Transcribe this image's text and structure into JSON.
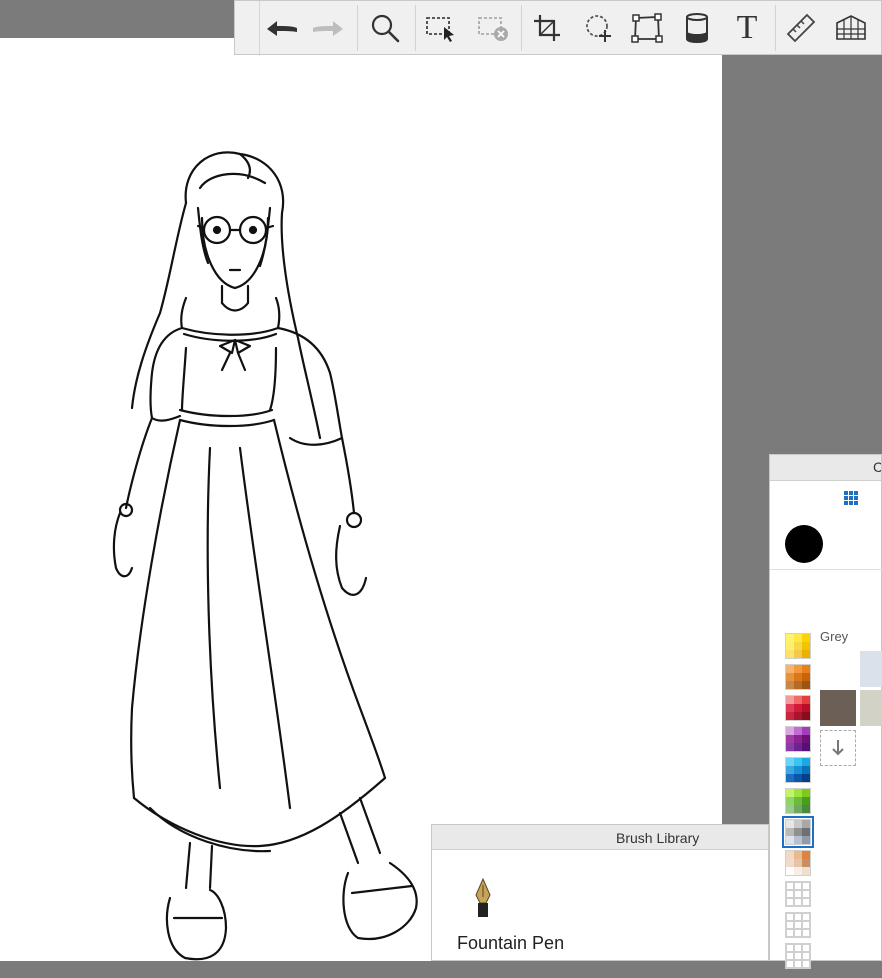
{
  "toolbar": {
    "tools": [
      {
        "name": "undo-icon",
        "label": "Undo"
      },
      {
        "name": "redo-icon",
        "label": "Redo"
      },
      {
        "name": "zoom-icon",
        "label": "Zoom"
      },
      {
        "name": "select-icon",
        "label": "Select"
      },
      {
        "name": "deselect-icon",
        "label": "Deselect"
      },
      {
        "name": "crop-icon",
        "label": "Crop"
      },
      {
        "name": "transform-icon",
        "label": "Transform"
      },
      {
        "name": "distort-icon",
        "label": "Distort"
      },
      {
        "name": "fill-icon",
        "label": "Fill"
      },
      {
        "name": "text-icon",
        "label": "Text"
      },
      {
        "name": "ruler-icon",
        "label": "Ruler"
      },
      {
        "name": "perspective-icon",
        "label": "Perspective"
      }
    ],
    "text_tool_glyph": "T"
  },
  "color_panel": {
    "title": "C",
    "current_color": "#000000",
    "category_label": "Grey",
    "grey_swatches": [
      "#dbe1ea",
      "#6b5f56",
      "#d3d2c6"
    ],
    "categories": [
      {
        "name": "yellow",
        "colors": [
          "#fff36b",
          "#ffe94a",
          "#ffd300",
          "#fff06b",
          "#f9d74a",
          "#f3c300",
          "#fde36b",
          "#f3c94a",
          "#eab100"
        ]
      },
      {
        "name": "orange",
        "colors": [
          "#f7b36b",
          "#f39a3d",
          "#e9801b",
          "#e5933d",
          "#d9781b",
          "#c86508",
          "#c9874a",
          "#b86b25",
          "#9d5510"
        ]
      },
      {
        "name": "red",
        "colors": [
          "#f59a9a",
          "#f06a6a",
          "#e63d3d",
          "#e23a5a",
          "#d31a3b",
          "#bb0d28",
          "#c9263f",
          "#a8162d",
          "#8a0d1f"
        ]
      },
      {
        "name": "purple",
        "colors": [
          "#d9a6e2",
          "#c36bd3",
          "#a33dbb",
          "#a23da6",
          "#8b2392",
          "#6e1076",
          "#8a3da6",
          "#6e2392",
          "#551076"
        ]
      },
      {
        "name": "blue",
        "colors": [
          "#6bd3f3",
          "#3dc3ef",
          "#1aa8e3",
          "#3da6e3",
          "#1a8fd3",
          "#0a72bb",
          "#1a6fc3",
          "#0d55a8",
          "#063f8a"
        ]
      },
      {
        "name": "green",
        "colors": [
          "#c3f36b",
          "#9de33d",
          "#7ccb1a",
          "#8fd36b",
          "#6bbb3d",
          "#4a9f1a",
          "#9acb8a",
          "#6fa860",
          "#4a8a3d"
        ]
      },
      {
        "name": "grey",
        "colors": [
          "#e6e6e6",
          "#c8c8c8",
          "#a8a8a8",
          "#b8b8b8",
          "#909090",
          "#707070",
          "#dde3ec",
          "#b8c2cf",
          "#8f9bab"
        ]
      },
      {
        "name": "skin",
        "colors": [
          "#f3d9c3",
          "#e9b98f",
          "#e0813d",
          "#f0dccb",
          "#e6c4a8",
          "#c98f63",
          "#ffffff",
          "#f7efe6",
          "#ede0d0"
        ]
      },
      {
        "name": "custom-1",
        "colors": []
      },
      {
        "name": "custom-2",
        "colors": []
      },
      {
        "name": "custom-3",
        "colors": []
      }
    ]
  },
  "brush_library": {
    "title": "Brush Library",
    "brush_name": "Fountain Pen"
  }
}
